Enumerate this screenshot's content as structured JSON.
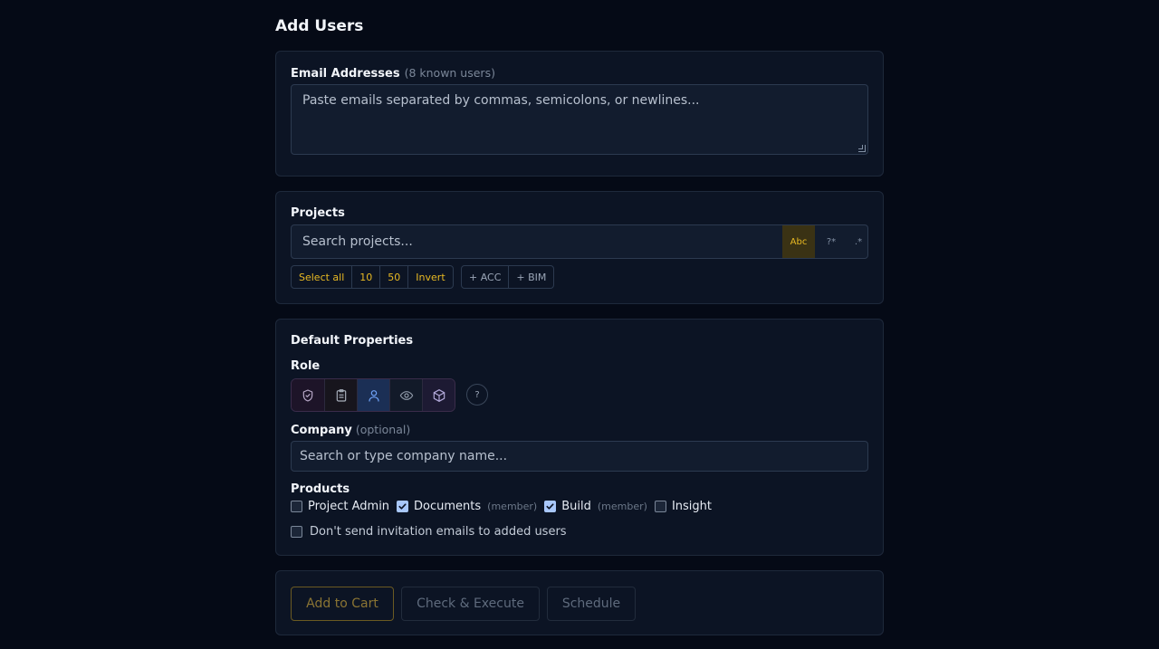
{
  "page": {
    "title": "Add Users"
  },
  "email": {
    "label": "Email Addresses",
    "hint": "(8 known users)",
    "placeholder": "Paste emails separated by commas, semicolons, or newlines..."
  },
  "projects": {
    "label": "Projects",
    "search_placeholder": "Search projects...",
    "modes": [
      "Abc",
      "?*",
      ".*"
    ],
    "select_buttons": [
      "Select all",
      "10",
      "50",
      "Invert"
    ],
    "add_buttons": [
      "+ ACC",
      "+ BIM"
    ]
  },
  "defaults": {
    "title": "Default Properties",
    "role_label": "Role",
    "roles": [
      "shield-check-icon",
      "clipboard-icon",
      "user-icon",
      "eye-icon",
      "cube-icon"
    ],
    "active_role": "user-icon",
    "help": "?",
    "company_label": "Company",
    "company_hint": "(optional)",
    "company_placeholder": "Search or type company name...",
    "products_label": "Products",
    "products": [
      {
        "label": "Project Admin",
        "checked": false,
        "sub": ""
      },
      {
        "label": "Documents",
        "checked": true,
        "sub": "(member)"
      },
      {
        "label": "Build",
        "checked": true,
        "sub": "(member)"
      },
      {
        "label": "Insight",
        "checked": false,
        "sub": ""
      }
    ],
    "no_send_label": "Don't send invitation emails to added users",
    "no_send_checked": false
  },
  "actions": {
    "add_to_cart": "Add to Cart",
    "check_execute": "Check & Execute",
    "schedule": "Schedule"
  },
  "colors": {
    "accent": "#e8b923",
    "active_role": "#1b2f55",
    "checkbox": "#a8c7fa"
  }
}
